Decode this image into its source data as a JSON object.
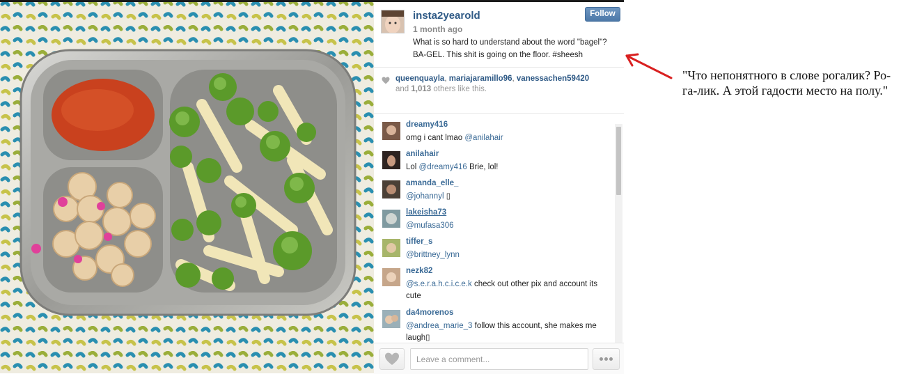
{
  "post": {
    "username": "insta2yearold",
    "time_ago": "1 month ago",
    "follow_label": "Follow",
    "caption_parts": [
      "What is so hard to understand about the word \"bagel\"?",
      "BA-GEL. This shit is going on the floor. #sheesh"
    ]
  },
  "likes": {
    "users": [
      "queenquayla",
      "mariajaramillo96",
      "vanessachen59420"
    ],
    "separator": ",",
    "prefix": "and",
    "count": "1,013",
    "suffix": "others like this."
  },
  "comments": [
    {
      "user": "dreamy416",
      "text_before": "omg i cant lmao ",
      "mention": "@anilahair",
      "text_after": ""
    },
    {
      "user": "anilahair",
      "text_before": "Lol ",
      "mention": "@dreamy416",
      "text_after": " Brie, lol!"
    },
    {
      "user": "amanda_elle_",
      "text_before": "",
      "mention": "@johannyl",
      "text_after": " ▯"
    },
    {
      "user": "lakeisha73",
      "text_before": "",
      "mention": "@mufasa306",
      "text_after": ""
    },
    {
      "user": "tiffer_s",
      "text_before": "",
      "mention": "@brittney_lynn",
      "text_after": ""
    },
    {
      "user": "nezk82",
      "text_before": "",
      "mention": "@s.e.r.a.h.c.i.c.e.k",
      "text_after": " check out other pix and account its cute"
    },
    {
      "user": "da4morenos",
      "text_before": "",
      "mention": "@andrea_marie_3",
      "text_after": " follow this account, she makes me laugh▯"
    }
  ],
  "comment_box": {
    "placeholder": "Leave a comment..."
  },
  "annotation": "\"Что непонятного в слове рогалик? Ро-га-лик. А этой гадости место на полу.\"",
  "icons": {
    "like": "heart-icon",
    "more": "ellipsis-icon",
    "arrow": "red-arrow-icon"
  },
  "colors": {
    "link": "#2f5a86",
    "follow_button": "#5a84b2",
    "arrow": "#d92020"
  }
}
